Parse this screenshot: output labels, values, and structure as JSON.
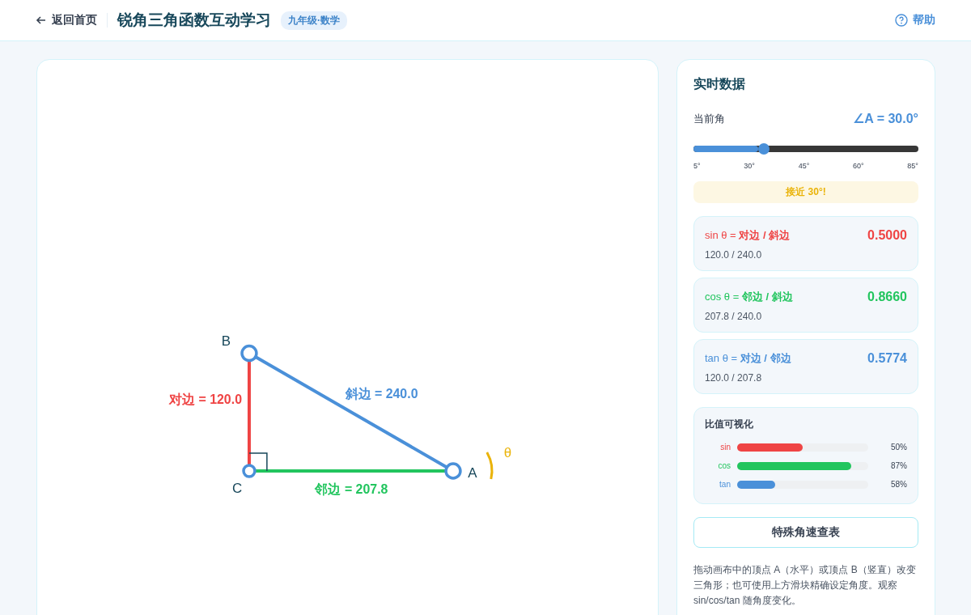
{
  "header": {
    "back": "返回首页",
    "title": "锐角三角函数互动学习",
    "badge": "九年级·数学",
    "help": "帮助"
  },
  "canvas": {
    "vertices": [
      {
        "label": "B",
        "kind": "top"
      },
      {
        "label": "C",
        "kind": "right"
      },
      {
        "label": "A",
        "kind": "end"
      }
    ],
    "sides": [
      {
        "kind": "opposite",
        "label": "对边 = 120.0"
      },
      {
        "kind": "hypotenuse",
        "label": "斜边 = 240.0"
      },
      {
        "kind": "adjacent",
        "label": "邻边 = 207.8"
      }
    ],
    "angle_label": "θ"
  },
  "panel": {
    "title": "实时数据",
    "angle_label": "当前角",
    "angle_value": "∠A = 30.0°",
    "slider": {
      "level": 0.3125,
      "ticks": [
        "5°",
        "30°",
        "45°",
        "60°",
        "85°"
      ]
    },
    "hint": "接近 30°!",
    "ratios": [
      {
        "kind": "sin",
        "formula": "sin θ = **对边 / 斜边**",
        "detail": "120.0 / 240.0",
        "value": "0.5000"
      },
      {
        "kind": "cos",
        "formula": "cos θ = **邻边 / 斜边**",
        "detail": "207.8 / 240.0",
        "value": "0.8660"
      },
      {
        "kind": "tan",
        "formula": "tan θ = **对边 / 邻边**",
        "detail": "120.0 / 207.8",
        "value": "0.5774"
      }
    ],
    "chart": {
      "title": "比值可视化",
      "bars": [
        {
          "kind": "sin",
          "label": "sin",
          "level": 0.5,
          "percent": "50%"
        },
        {
          "kind": "cos",
          "label": "cos",
          "level": 0.87,
          "percent": "87%"
        },
        {
          "kind": "tan",
          "label": "tan",
          "level": 0.29,
          "percent": "58%"
        }
      ]
    },
    "table_button": "特殊角速查表",
    "note": "拖动画布中的顶点 A（水平）或顶点 B（竖直）改变三角形；也可使用上方滑块精确设定角度。观察 sin/cos/tan 随角度变化。"
  }
}
